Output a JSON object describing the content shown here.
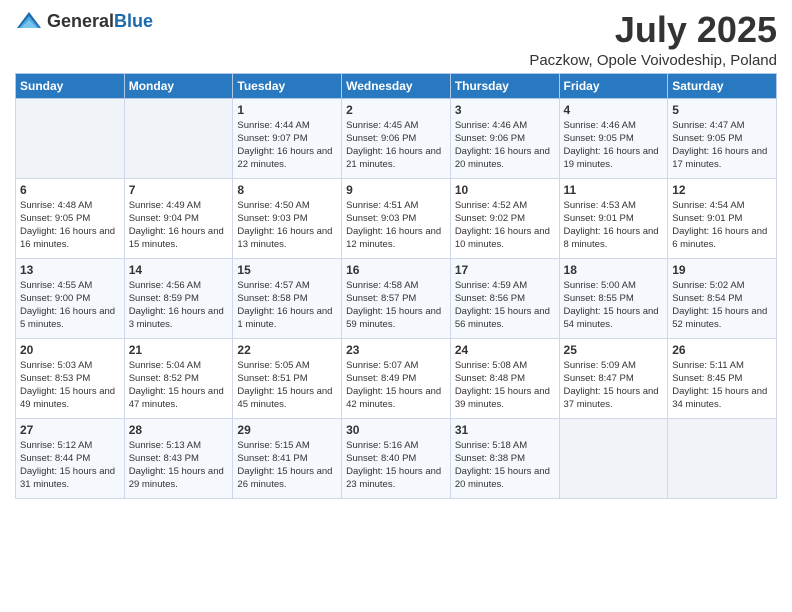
{
  "header": {
    "logo_general": "General",
    "logo_blue": "Blue",
    "month_title": "July 2025",
    "location": "Paczkow, Opole Voivodeship, Poland"
  },
  "days_of_week": [
    "Sunday",
    "Monday",
    "Tuesday",
    "Wednesday",
    "Thursday",
    "Friday",
    "Saturday"
  ],
  "weeks": [
    [
      {
        "day": "",
        "info": ""
      },
      {
        "day": "",
        "info": ""
      },
      {
        "day": "1",
        "info": "Sunrise: 4:44 AM\nSunset: 9:07 PM\nDaylight: 16 hours\nand 22 minutes."
      },
      {
        "day": "2",
        "info": "Sunrise: 4:45 AM\nSunset: 9:06 PM\nDaylight: 16 hours\nand 21 minutes."
      },
      {
        "day": "3",
        "info": "Sunrise: 4:46 AM\nSunset: 9:06 PM\nDaylight: 16 hours\nand 20 minutes."
      },
      {
        "day": "4",
        "info": "Sunrise: 4:46 AM\nSunset: 9:05 PM\nDaylight: 16 hours\nand 19 minutes."
      },
      {
        "day": "5",
        "info": "Sunrise: 4:47 AM\nSunset: 9:05 PM\nDaylight: 16 hours\nand 17 minutes."
      }
    ],
    [
      {
        "day": "6",
        "info": "Sunrise: 4:48 AM\nSunset: 9:05 PM\nDaylight: 16 hours\nand 16 minutes."
      },
      {
        "day": "7",
        "info": "Sunrise: 4:49 AM\nSunset: 9:04 PM\nDaylight: 16 hours\nand 15 minutes."
      },
      {
        "day": "8",
        "info": "Sunrise: 4:50 AM\nSunset: 9:03 PM\nDaylight: 16 hours\nand 13 minutes."
      },
      {
        "day": "9",
        "info": "Sunrise: 4:51 AM\nSunset: 9:03 PM\nDaylight: 16 hours\nand 12 minutes."
      },
      {
        "day": "10",
        "info": "Sunrise: 4:52 AM\nSunset: 9:02 PM\nDaylight: 16 hours\nand 10 minutes."
      },
      {
        "day": "11",
        "info": "Sunrise: 4:53 AM\nSunset: 9:01 PM\nDaylight: 16 hours\nand 8 minutes."
      },
      {
        "day": "12",
        "info": "Sunrise: 4:54 AM\nSunset: 9:01 PM\nDaylight: 16 hours\nand 6 minutes."
      }
    ],
    [
      {
        "day": "13",
        "info": "Sunrise: 4:55 AM\nSunset: 9:00 PM\nDaylight: 16 hours\nand 5 minutes."
      },
      {
        "day": "14",
        "info": "Sunrise: 4:56 AM\nSunset: 8:59 PM\nDaylight: 16 hours\nand 3 minutes."
      },
      {
        "day": "15",
        "info": "Sunrise: 4:57 AM\nSunset: 8:58 PM\nDaylight: 16 hours\nand 1 minute."
      },
      {
        "day": "16",
        "info": "Sunrise: 4:58 AM\nSunset: 8:57 PM\nDaylight: 15 hours\nand 59 minutes."
      },
      {
        "day": "17",
        "info": "Sunrise: 4:59 AM\nSunset: 8:56 PM\nDaylight: 15 hours\nand 56 minutes."
      },
      {
        "day": "18",
        "info": "Sunrise: 5:00 AM\nSunset: 8:55 PM\nDaylight: 15 hours\nand 54 minutes."
      },
      {
        "day": "19",
        "info": "Sunrise: 5:02 AM\nSunset: 8:54 PM\nDaylight: 15 hours\nand 52 minutes."
      }
    ],
    [
      {
        "day": "20",
        "info": "Sunrise: 5:03 AM\nSunset: 8:53 PM\nDaylight: 15 hours\nand 49 minutes."
      },
      {
        "day": "21",
        "info": "Sunrise: 5:04 AM\nSunset: 8:52 PM\nDaylight: 15 hours\nand 47 minutes."
      },
      {
        "day": "22",
        "info": "Sunrise: 5:05 AM\nSunset: 8:51 PM\nDaylight: 15 hours\nand 45 minutes."
      },
      {
        "day": "23",
        "info": "Sunrise: 5:07 AM\nSunset: 8:49 PM\nDaylight: 15 hours\nand 42 minutes."
      },
      {
        "day": "24",
        "info": "Sunrise: 5:08 AM\nSunset: 8:48 PM\nDaylight: 15 hours\nand 39 minutes."
      },
      {
        "day": "25",
        "info": "Sunrise: 5:09 AM\nSunset: 8:47 PM\nDaylight: 15 hours\nand 37 minutes."
      },
      {
        "day": "26",
        "info": "Sunrise: 5:11 AM\nSunset: 8:45 PM\nDaylight: 15 hours\nand 34 minutes."
      }
    ],
    [
      {
        "day": "27",
        "info": "Sunrise: 5:12 AM\nSunset: 8:44 PM\nDaylight: 15 hours\nand 31 minutes."
      },
      {
        "day": "28",
        "info": "Sunrise: 5:13 AM\nSunset: 8:43 PM\nDaylight: 15 hours\nand 29 minutes."
      },
      {
        "day": "29",
        "info": "Sunrise: 5:15 AM\nSunset: 8:41 PM\nDaylight: 15 hours\nand 26 minutes."
      },
      {
        "day": "30",
        "info": "Sunrise: 5:16 AM\nSunset: 8:40 PM\nDaylight: 15 hours\nand 23 minutes."
      },
      {
        "day": "31",
        "info": "Sunrise: 5:18 AM\nSunset: 8:38 PM\nDaylight: 15 hours\nand 20 minutes."
      },
      {
        "day": "",
        "info": ""
      },
      {
        "day": "",
        "info": ""
      }
    ]
  ]
}
